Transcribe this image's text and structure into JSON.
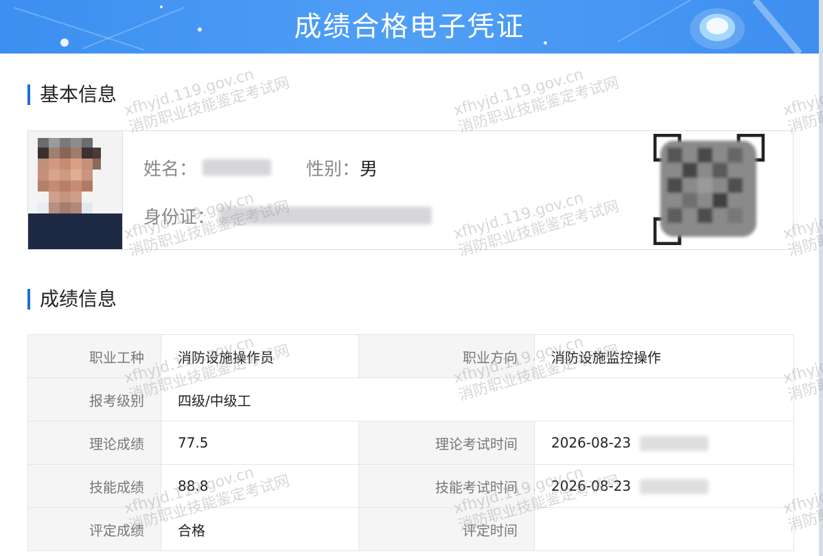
{
  "header": {
    "title": "成绩合格电子凭证"
  },
  "basic_info": {
    "section_title": "基本信息",
    "name_label": "姓名：",
    "gender_label": "性别：",
    "gender_value": "男",
    "id_label": "身份证："
  },
  "grades": {
    "section_title": "成绩信息",
    "rows": [
      {
        "k1": "职业工种",
        "v1": "消防设施操作员",
        "k2": "职业方向",
        "v2": "消防设施监控操作"
      },
      {
        "k1": "报考级别",
        "v1": "四级/中级工"
      },
      {
        "k1": "理论成绩",
        "v1": "77.5",
        "k2": "理论考试时间",
        "v2": "2026-08-23"
      },
      {
        "k1": "技能成绩",
        "v1": "88.8",
        "k2": "技能考试时间",
        "v2": "2026-08-23"
      },
      {
        "k1": "评定成绩",
        "v1": "合格",
        "k2": "评定时间",
        "v2": ""
      }
    ]
  },
  "watermark": {
    "line1": "xfhyjd.119.gov.cn",
    "line2": "消防职业技能鉴定考试网"
  },
  "colors": {
    "header_blue": "#4a9af5",
    "accent_bar": "#1e6fd9",
    "skill_score_blue": "#4a90e2",
    "pass_green": "#2a9d3c"
  }
}
